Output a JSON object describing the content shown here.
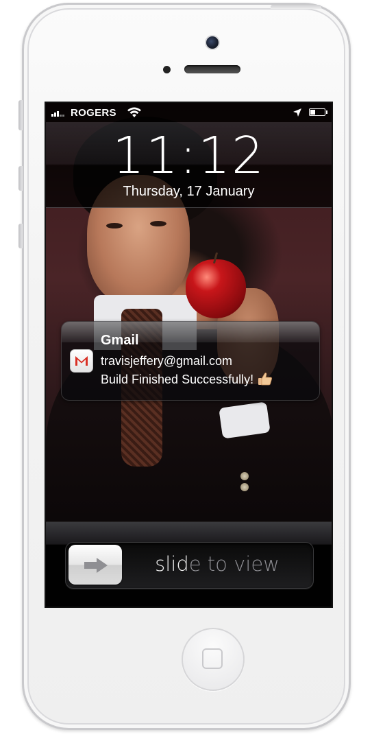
{
  "status_bar": {
    "carrier": "ROGERS",
    "signal_bars": 3,
    "battery_level": 0.35
  },
  "lock_screen": {
    "time": "11:12",
    "date": "Thursday, 17 January"
  },
  "notification": {
    "app": "Gmail",
    "sender": "travisjeffery@gmail.com",
    "message": "Build Finished Successfully!",
    "icon": "gmail-icon",
    "emoji": "thumbs-up-icon"
  },
  "unlock_slider": {
    "label_highlight": "slid",
    "label_rest": "e to view"
  },
  "colors": {
    "gmail_red": "#d93025",
    "slider_text": "#8e8e93"
  }
}
